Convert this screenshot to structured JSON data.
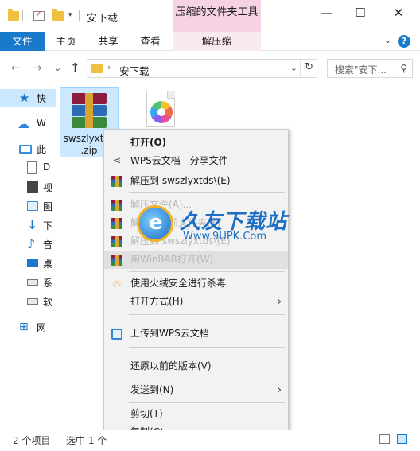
{
  "titlebar": {
    "title": "安下载",
    "context_tab_header": "压缩的文件夹工具",
    "minimize": "—",
    "maximize": "☐",
    "close": "✕",
    "quick_access_dropdown": "▾"
  },
  "ribbon": {
    "tabs": [
      "文件",
      "主页",
      "共享",
      "查看",
      "解压缩"
    ],
    "help": "?",
    "expand": "⌄"
  },
  "address": {
    "back": "←",
    "forward": "→",
    "recent": "⌄",
    "up": "↑",
    "path_separator": "›",
    "path": "安下载",
    "dropdown": "⌄",
    "refresh": "↻",
    "search_placeholder": "搜索\"安下...",
    "search_icon": "⚲"
  },
  "navpane": {
    "items": [
      {
        "label": "快",
        "icon": "star-icon"
      },
      {
        "label": "W",
        "icon": "cloud-icon"
      },
      {
        "label": "此",
        "icon": "computer-icon"
      },
      {
        "label": "D",
        "icon": "document-icon"
      },
      {
        "label": "视",
        "icon": "video-icon"
      },
      {
        "label": "图",
        "icon": "picture-icon"
      },
      {
        "label": "下",
        "icon": "download-icon"
      },
      {
        "label": "音",
        "icon": "music-icon"
      },
      {
        "label": "桌",
        "icon": "desktop-icon"
      },
      {
        "label": "系",
        "icon": "drive-icon"
      },
      {
        "label": "软",
        "icon": "drive-icon"
      },
      {
        "label": "网",
        "icon": "network-icon"
      }
    ]
  },
  "files": [
    {
      "name": "swszlyxtds\n.zip",
      "icon": "zip-archive-icon",
      "selected": true
    },
    {
      "name": "",
      "icon": "installer-icon",
      "selected": false
    }
  ],
  "context_menu": {
    "items": [
      {
        "label": "打开(O)",
        "bold": true
      },
      {
        "label": "WPS云文档 - 分享文件",
        "icon": "share-icon"
      },
      {
        "label": "解压到 swszlyxtds\\(E)",
        "icon": "winrar-icon"
      },
      {
        "label": "解压文件(A)...",
        "icon": "winrar-icon"
      },
      {
        "label": "解压到当前文件夹(X)",
        "icon": "winrar-icon"
      },
      {
        "label": "解压到 swszlyxtds\\(E)",
        "icon": "winrar-icon"
      },
      {
        "label": "用WinRAR打开(W)",
        "icon": "winrar-icon"
      },
      {
        "label": "使用火绒安全进行杀毒",
        "icon": "huorong-icon"
      },
      {
        "label": "打开方式(H)",
        "submenu": true
      },
      {
        "label": "上传到WPS云文档",
        "icon": "wps-cloud-icon"
      },
      {
        "label": "还原以前的版本(V)"
      },
      {
        "label": "发送到(N)",
        "submenu": true
      },
      {
        "label": "剪切(T)"
      },
      {
        "label": "复制(C)"
      }
    ],
    "submenu_arrow": "›"
  },
  "watermark": {
    "name": "久友下载站",
    "url": "Www.9UPK.Com"
  },
  "statusbar": {
    "item_count": "2 个项目",
    "selected": "选中 1 个"
  },
  "colors": {
    "accent": "#1979ca",
    "context_tab": "#f6d3e4",
    "selection": "#cce8ff",
    "menu_bg": "#f2f2f2"
  }
}
